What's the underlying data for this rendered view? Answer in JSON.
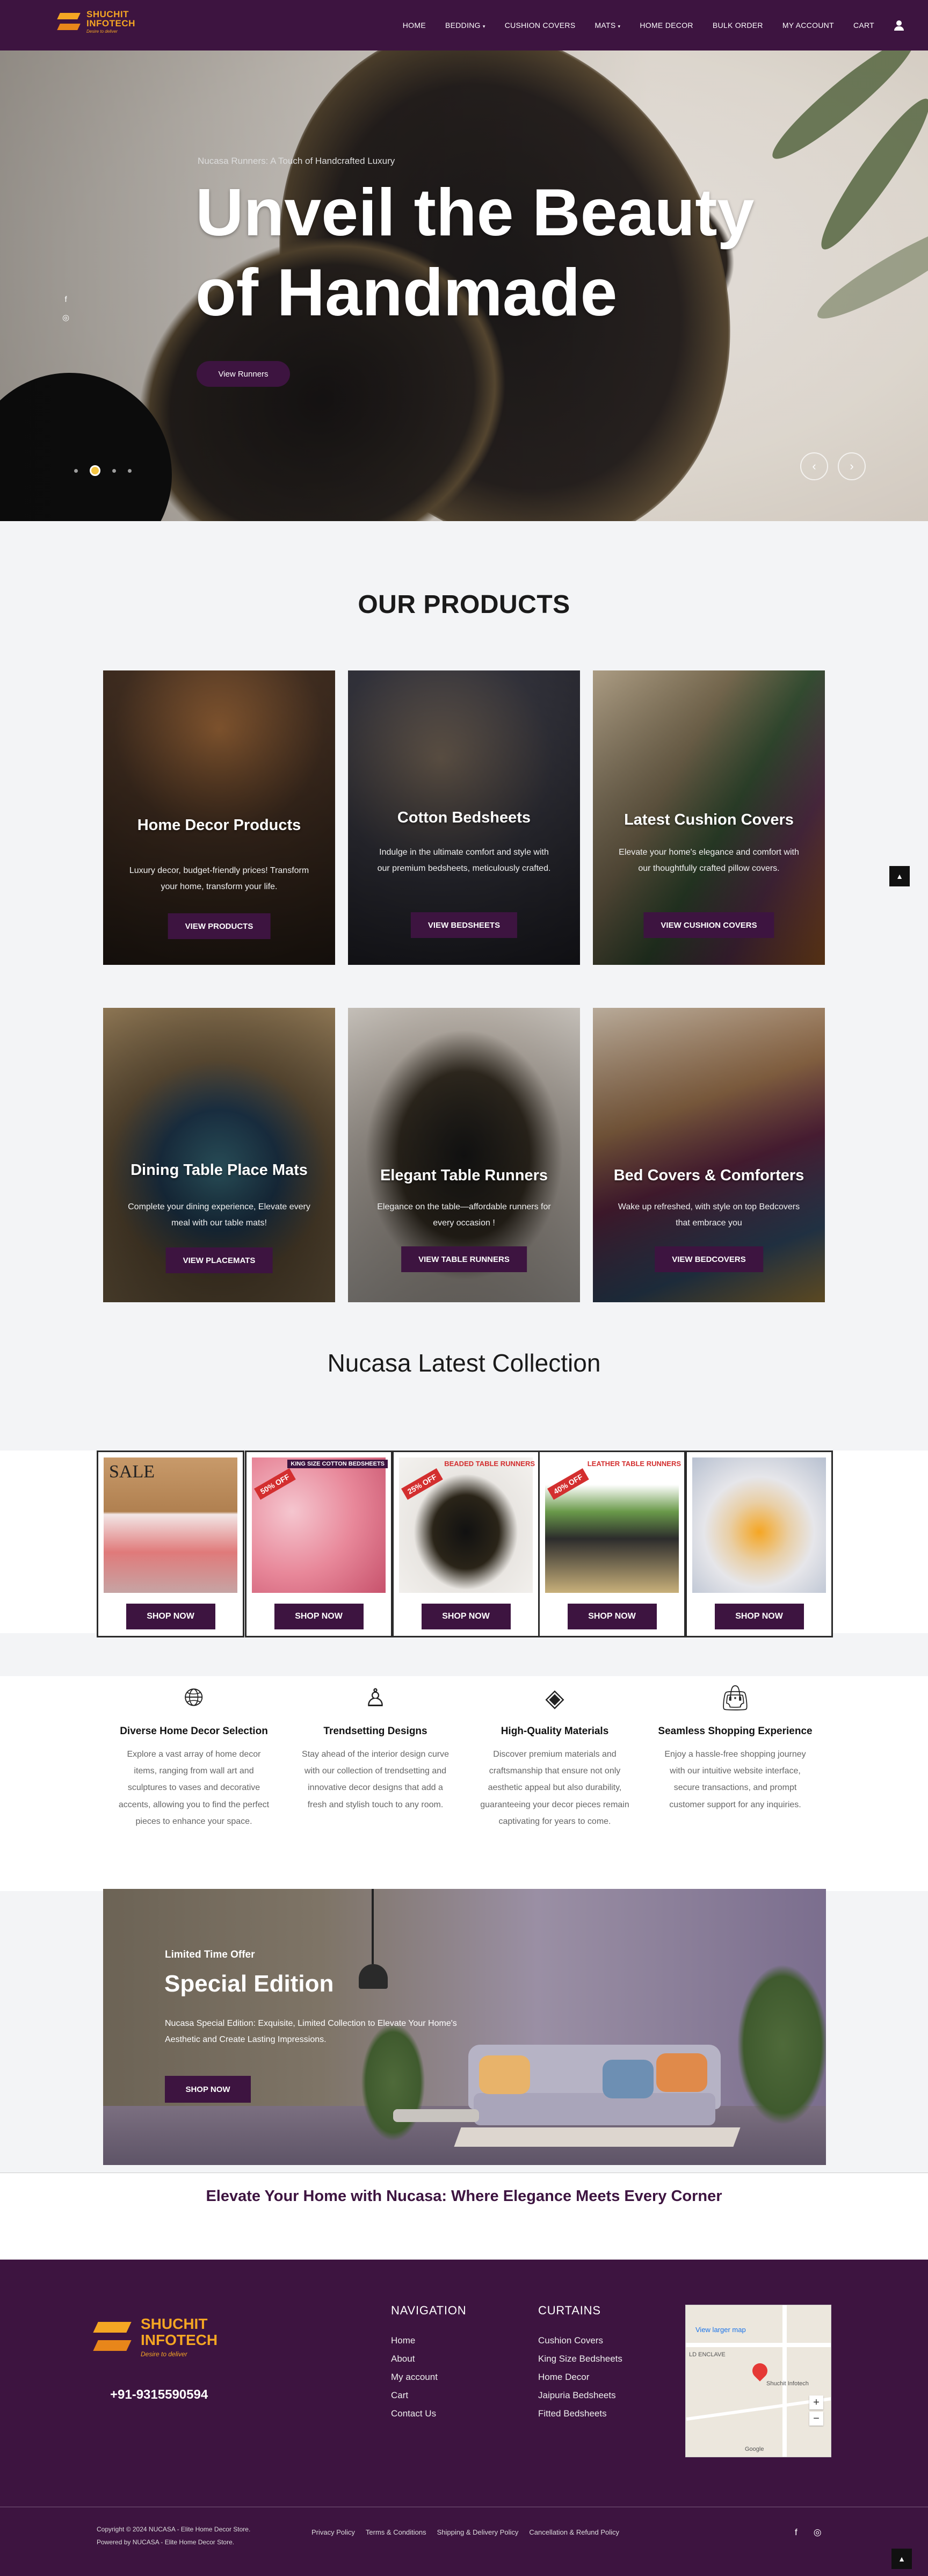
{
  "brand": {
    "line1": "SHUCHIT",
    "line2": "INFOTECH",
    "slogan": "Desire to deliver"
  },
  "nav": {
    "items": [
      "HOME",
      "BEDDING",
      "CUSHION COVERS",
      "MATS",
      "HOME DECOR",
      "BULK ORDER",
      "MY ACCOUNT",
      "CART"
    ]
  },
  "hero": {
    "subtitle": "Nucasa Runners: A Touch of Handcrafted Luxury",
    "title_line1": "Unveil the Beauty",
    "title_line2": "of Handmade",
    "button": "View Runners"
  },
  "products": {
    "title": "OUR PRODUCTS",
    "cards": [
      {
        "title": "Home Decor Products",
        "desc": "Luxury decor, budget-friendly prices! Transform your home, transform your life.",
        "button": "VIEW PRODUCTS"
      },
      {
        "title": "Cotton Bedsheets",
        "desc": "Indulge in the ultimate comfort and style with our premium bedsheets, meticulously crafted.",
        "button": "VIEW BEDSHEETS"
      },
      {
        "title": "Latest Cushion Covers",
        "desc": "Elevate your home's elegance and comfort with our thoughtfully crafted pillow covers.",
        "button": "VIEW CUSHION COVERS"
      },
      {
        "title": "Dining Table Place Mats",
        "desc": "Complete your dining experience, Elevate every meal with our table mats!",
        "button": "VIEW PLACEMATS"
      },
      {
        "title": "Elegant Table Runners",
        "desc": "Elegance on the table—affordable runners for every occasion !",
        "button": "VIEW TABLE RUNNERS"
      },
      {
        "title": "Bed Covers & Comforters",
        "desc": "Wake up refreshed, with style on top Bedcovers that embrace you",
        "button": "VIEW BEDCOVERS"
      }
    ]
  },
  "latest": {
    "title": "Nucasa Latest Collection",
    "items": [
      {
        "badge": "SALE",
        "label": "",
        "button": "SHOP NOW"
      },
      {
        "badge": "50% OFF",
        "label": "KING SIZE COTTON BEDSHEETS",
        "button": "SHOP NOW"
      },
      {
        "badge": "25% OFF",
        "label": "BEADED TABLE RUNNERS",
        "button": "SHOP NOW"
      },
      {
        "badge": "40% OFF",
        "label": "LEATHER TABLE RUNNERS",
        "button": "SHOP NOW"
      },
      {
        "badge": "",
        "label": "",
        "button": "SHOP NOW"
      }
    ]
  },
  "features": [
    {
      "icon": "globe-icon",
      "title": "Diverse Home Decor Selection",
      "desc": "Explore a vast array of home decor items, ranging from wall art and sculptures to vases and decorative accents, allowing you to find the perfect pieces to enhance your space."
    },
    {
      "icon": "dress-icon",
      "title": "Trendsetting Designs",
      "desc": "Stay ahead of the interior design curve with our collection of trendsetting and innovative decor designs that add a fresh and stylish touch to any room."
    },
    {
      "icon": "price-tag-icon",
      "title": "High-Quality Materials",
      "desc": "Discover premium materials and craftsmanship that ensure not only aesthetic appeal but also durability, guaranteeing your decor pieces remain captivating for years to come."
    },
    {
      "icon": "shopping-bag-icon",
      "title": "Seamless Shopping Experience",
      "desc": "Enjoy a hassle-free shopping journey with our intuitive website interface, secure transactions, and prompt customer support for any inquiries."
    }
  ],
  "special": {
    "eyebrow": "Limited Time Offer",
    "title": "Special Edition",
    "desc": "Nucasa Special Edition: Exquisite, Limited Collection to Elevate Your Home's Aesthetic and Create Lasting Impressions.",
    "button": "SHOP NOW"
  },
  "tagline": "Elevate Your Home with Nucasa: Where Elegance Meets Every Corner",
  "footer": {
    "phone": "+91-9315590594",
    "nav_heading": "NAVIGATION",
    "nav_links": [
      "Home",
      "About",
      "My account",
      "Cart",
      "Contact Us"
    ],
    "curtains_heading": "CURTAINS",
    "curtain_links": [
      "Cushion Covers",
      "King Size Bedsheets",
      "Home Decor",
      "Jaipuria Bedsheets",
      "Fitted Bedsheets"
    ],
    "map_link": "View larger map",
    "map_labels": [
      "LD ENCLAVE",
      "Shuchit Infotech",
      "Google"
    ],
    "copyright_line1": "Copyright © 2024 NUCASA - Elite Home Decor Store.",
    "copyright_line2": "Powered by NUCASA - Elite Home Decor Store.",
    "legal": [
      "Privacy Policy",
      "Terms & Conditions",
      "Shipping & Delivery Policy",
      "Cancellation & Refund Policy"
    ]
  }
}
